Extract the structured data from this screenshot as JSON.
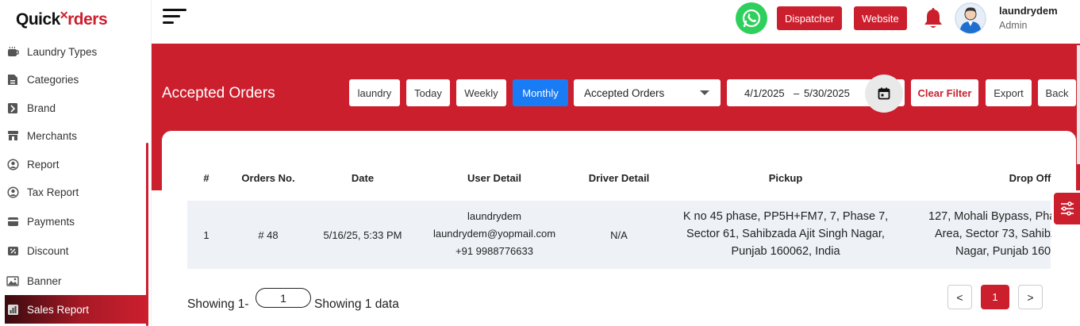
{
  "brand": {
    "part1": "Quick",
    "part2": "rders",
    "accent": "#cc1f2e"
  },
  "sidebar": {
    "items": [
      {
        "label": "Laundry Types",
        "icon": "laundry-icon"
      },
      {
        "label": "Categories",
        "icon": "categories-icon"
      },
      {
        "label": "Brand",
        "icon": "brand-icon"
      },
      {
        "label": "Merchants",
        "icon": "merchants-icon"
      },
      {
        "label": "Report",
        "icon": "report-icon"
      },
      {
        "label": "Tax Report",
        "icon": "tax-report-icon"
      },
      {
        "label": "Payments",
        "icon": "payments-icon"
      },
      {
        "label": "Discount",
        "icon": "discount-icon"
      },
      {
        "label": "Banner",
        "icon": "banner-icon"
      },
      {
        "label": "Sales Report",
        "icon": "sales-report-icon",
        "active": true
      }
    ]
  },
  "topbar": {
    "dispatcher_label": "Dispatcher",
    "website_label": "Website",
    "user_name": "laundrydem",
    "user_role": "Admin"
  },
  "header": {
    "title": "Accepted Orders",
    "filters": {
      "laundry": "laundry",
      "today": "Today",
      "weekly": "Weekly",
      "monthly": "Monthly",
      "active": "Monthly"
    },
    "status_select": "Accepted Orders",
    "date_from": "4/1/2025",
    "date_sep": "–",
    "date_to": "5/30/2025",
    "clear_label": "Clear Filter",
    "export_label": "Export",
    "back_label": "Back"
  },
  "table": {
    "columns": [
      "#",
      "Orders No.",
      "Date",
      "User Detail",
      "Driver Detail",
      "Pickup",
      "Drop Off"
    ],
    "rows": [
      {
        "index": "1",
        "order_no": "# 48",
        "date": "5/16/25, 5:33 PM",
        "user_name": "laundrydem",
        "user_email": "laundrydem@yopmail.com",
        "user_phone": "+91 9988776633",
        "driver": "N/A",
        "pickup_line1": "K no 45 phase, PP5H+FM7, 7, Phase 7,",
        "pickup_line2": "Sector 61, Sahibzada Ajit Singh Nagar,",
        "pickup_line3": "Punjab 160062, India",
        "drop_line1": "127, Mohali Bypass, Pha",
        "drop_line2": "Area, Sector 73, Sahibz",
        "drop_line3": "Nagar, Punjab 160"
      }
    ]
  },
  "footer": {
    "showing_prefix": "Showing 1-",
    "page_size": "1",
    "showing_suffix": "Showing 1 data",
    "prev": "<",
    "current_page": "1",
    "next": ">"
  }
}
